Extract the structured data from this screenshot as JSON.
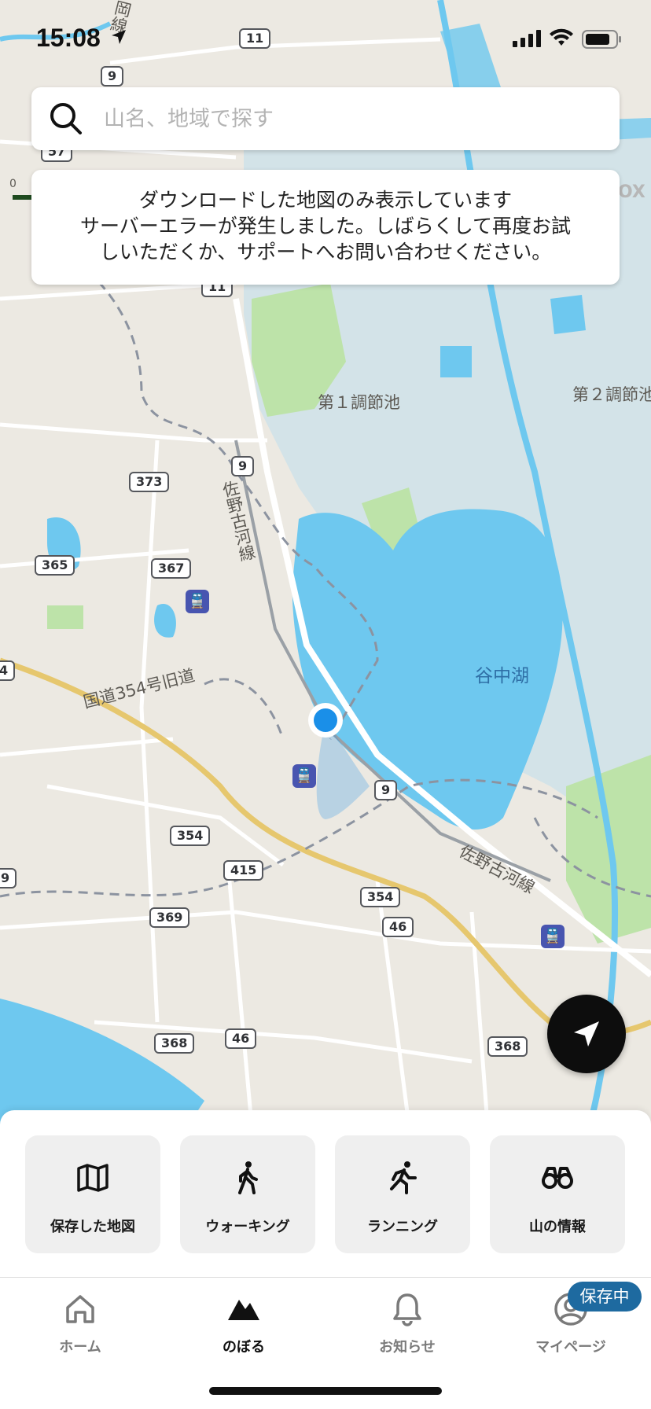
{
  "status_bar": {
    "time": "15:08"
  },
  "search": {
    "placeholder": "山名、地域で探す"
  },
  "notice": {
    "line1": "ダウンロードした地図のみ表示しています",
    "line2": "サーバーエラーが発生しました。しばらくして再度お試",
    "line3": "しいただくか、サポートへお問い合わせください。"
  },
  "map": {
    "labels": {
      "pond1": "第１調節池",
      "pond2": "第２調節池",
      "lake": "谷中湖",
      "railway_vertical": "佐野古河線",
      "railway_diagonal": "佐野古河線",
      "old_road": "国道354号旧道",
      "rail_line_top": "岡線",
      "scale_zero": "0",
      "logo_fragment": "OX"
    },
    "routes": [
      "11",
      "9",
      "57",
      "11",
      "373",
      "9",
      "365",
      "367",
      "4",
      "9",
      "354",
      "415",
      "354",
      "46",
      "369",
      "368",
      "46",
      "368",
      "9"
    ]
  },
  "actions": [
    {
      "label": "保存した地図",
      "icon": "map-icon"
    },
    {
      "label": "ウォーキング",
      "icon": "walking-icon"
    },
    {
      "label": "ランニング",
      "icon": "running-icon"
    },
    {
      "label": "山の情報",
      "icon": "binoculars-icon"
    }
  ],
  "tabs": [
    {
      "label": "ホーム",
      "icon": "home-icon"
    },
    {
      "label": "のぼる",
      "icon": "mountain-icon"
    },
    {
      "label": "お知らせ",
      "icon": "bell-icon"
    },
    {
      "label": "マイページ",
      "icon": "profile-icon"
    }
  ],
  "saving_badge": "保存中",
  "colors": {
    "water": "#6ec8ef",
    "land": "#ece9e2",
    "green": "#bde3a9",
    "wetland": "#cfe0e8",
    "road_major": "#e6c76e",
    "location_dot": "#1a8fe8",
    "saving_badge": "#1e6aa0"
  }
}
